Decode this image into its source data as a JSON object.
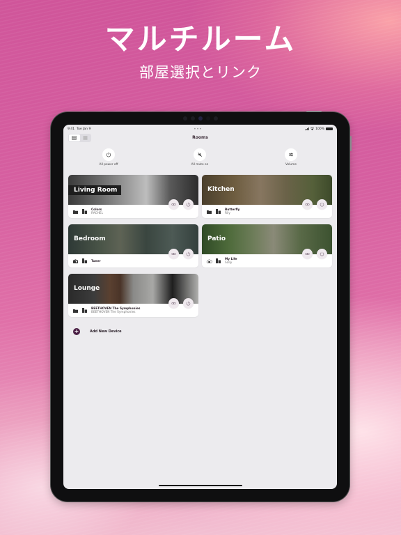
{
  "promo": {
    "headline": "マルチルーム",
    "subhead": "部屋選択とリンク"
  },
  "status_bar": {
    "time": "9:41",
    "date": "Tue Jan 9",
    "center": "•••",
    "battery": "100%"
  },
  "toolbar": {
    "title": "Rooms",
    "view_toggle": [
      {
        "icon": "large-tiles-icon",
        "active": true
      },
      {
        "icon": "list-view-icon",
        "active": false
      }
    ]
  },
  "quick_actions": [
    {
      "label": "All power off",
      "icon": "power-icon"
    },
    {
      "label": "All mute on",
      "icon": "mute-icon"
    },
    {
      "label": "Volume",
      "icon": "sliders-icon"
    }
  ],
  "rooms": [
    {
      "name": "Living Room",
      "source_icon": "folder-icon",
      "track": "Colors",
      "artist": "RACHEL"
    },
    {
      "name": "Kitchen",
      "source_icon": "folder-icon",
      "track": "Butterfly",
      "artist": "Rily"
    },
    {
      "name": "Bedroom",
      "source_icon": "radio-icon",
      "track": "Tuner",
      "artist": ""
    },
    {
      "name": "Patio",
      "source_icon": "cloud-radio-icon",
      "track": "My Life",
      "artist": "Sally"
    },
    {
      "name": "Lounge",
      "source_icon": "folder-icon",
      "track": "BEETHOVEN The Symphonies",
      "artist": "BEETHOVEN The Symphonies"
    }
  ],
  "add_device": {
    "label": "Add New Device",
    "icon": "plus-icon"
  },
  "colors": {
    "accent": "#4a1f44",
    "screen_bg": "#ecebee",
    "button_bg": "#efe9ee"
  }
}
